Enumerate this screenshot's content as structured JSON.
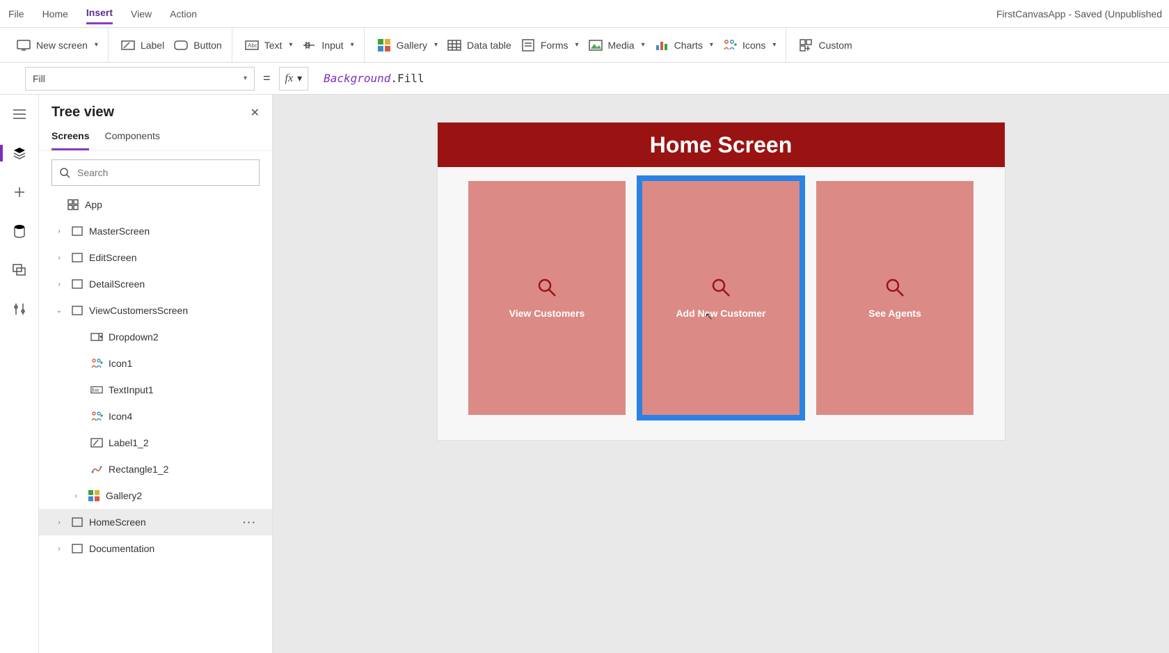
{
  "menubar": {
    "items": [
      "File",
      "Home",
      "Insert",
      "View",
      "Action"
    ],
    "active": "Insert",
    "app_title": "FirstCanvasApp - Saved (Unpublished"
  },
  "ribbon": {
    "new_screen": "New screen",
    "label": "Label",
    "button": "Button",
    "text": "Text",
    "input": "Input",
    "gallery": "Gallery",
    "data_table": "Data table",
    "forms": "Forms",
    "media": "Media",
    "charts": "Charts",
    "icons": "Icons",
    "custom": "Custom"
  },
  "formula": {
    "property": "Fill",
    "equals": "=",
    "fx": "fx",
    "obj": "Background",
    "dot_prop": ".Fill"
  },
  "tree": {
    "title": "Tree view",
    "tabs": [
      "Screens",
      "Components"
    ],
    "active_tab": "Screens",
    "search_placeholder": "Search",
    "app_label": "App",
    "nodes": [
      {
        "label": "MasterScreen",
        "type": "screen",
        "depth": 1,
        "arrow": ">"
      },
      {
        "label": "EditScreen",
        "type": "screen",
        "depth": 1,
        "arrow": ">"
      },
      {
        "label": "DetailScreen",
        "type": "screen",
        "depth": 1,
        "arrow": ">"
      },
      {
        "label": "ViewCustomersScreen",
        "type": "screen",
        "depth": 1,
        "arrow": "v"
      },
      {
        "label": "Dropdown2",
        "type": "dropdown",
        "depth": 2,
        "arrow": ""
      },
      {
        "label": "Icon1",
        "type": "iconpeople",
        "depth": 2,
        "arrow": ""
      },
      {
        "label": "TextInput1",
        "type": "textinput",
        "depth": 2,
        "arrow": ""
      },
      {
        "label": "Icon4",
        "type": "iconpeople",
        "depth": 2,
        "arrow": ""
      },
      {
        "label": "Label1_2",
        "type": "label",
        "depth": 2,
        "arrow": ""
      },
      {
        "label": "Rectangle1_2",
        "type": "rect",
        "depth": 2,
        "arrow": ""
      },
      {
        "label": "Gallery2",
        "type": "gallery",
        "depth": 2,
        "arrow": ">",
        "indent3": true
      },
      {
        "label": "HomeScreen",
        "type": "screen",
        "depth": 1,
        "arrow": ">",
        "selected": true,
        "more": true
      },
      {
        "label": "Documentation",
        "type": "screen",
        "depth": 1,
        "arrow": ">"
      }
    ]
  },
  "canvas": {
    "header": "Home Screen",
    "cards": [
      {
        "label": "View Customers",
        "selected": false
      },
      {
        "label": "Add New Customer",
        "selected": true
      },
      {
        "label": "See Agents",
        "selected": false
      }
    ]
  }
}
